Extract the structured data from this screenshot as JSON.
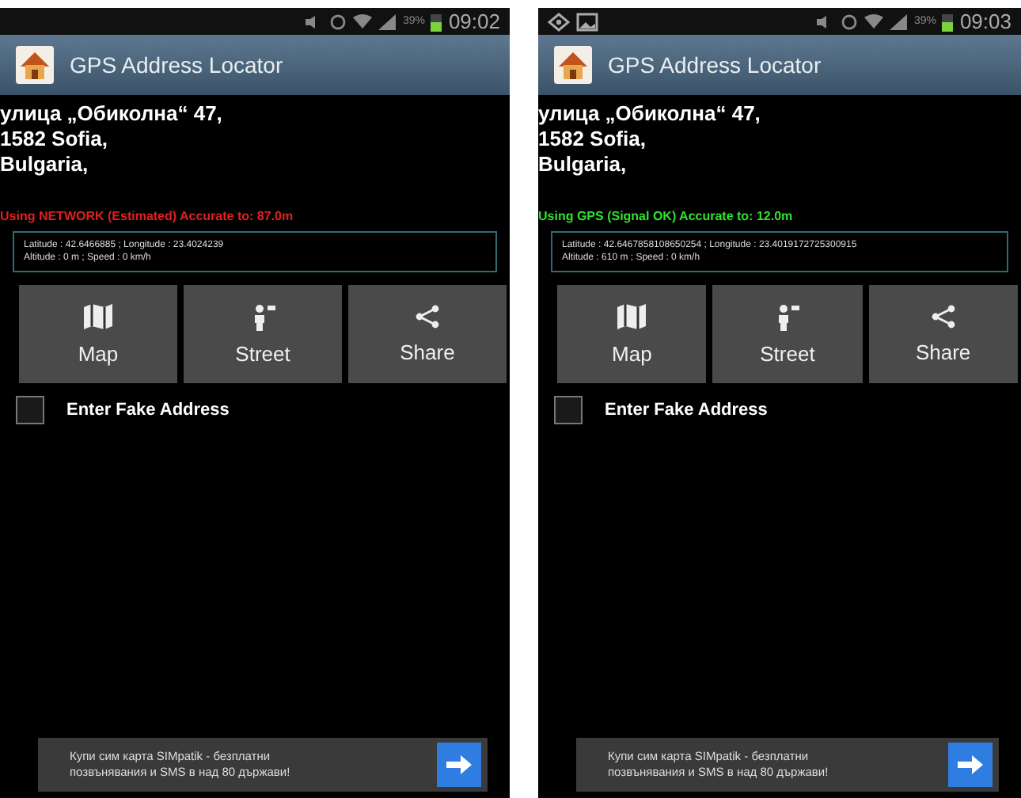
{
  "screens": [
    {
      "status_bar": {
        "time": "09:02",
        "battery": "39%",
        "notification_icons": false
      },
      "app_title": "GPS Address Locator",
      "address": [
        "улица „Обиколна“ 47,",
        "1582 Sofia,",
        "Bulgaria,"
      ],
      "fix_status": {
        "kind": "network",
        "text": "Using NETWORK (Estimated) Accurate to: 87.0m"
      },
      "location_info": [
        "Latitude : 42.6466885 ; Longitude : 23.4024239",
        "Altitude : 0 m ; Speed : 0 km/h"
      ],
      "buttons": [
        {
          "kind": "map",
          "label": "Map"
        },
        {
          "kind": "street",
          "label": "Street"
        },
        {
          "kind": "share",
          "label": "Share"
        }
      ],
      "fake_address": {
        "label": "Enter Fake Address",
        "checked": false
      },
      "ad": {
        "lines": [
          "Купи сим карта SIMpatik - безплатни",
          "позвънявания и SMS в над 80 държави!"
        ]
      }
    },
    {
      "status_bar": {
        "time": "09:03",
        "battery": "39%",
        "notification_icons": true
      },
      "app_title": "GPS Address Locator",
      "address": [
        "улица „Обиколна“ 47,",
        "1582 Sofia,",
        "Bulgaria,"
      ],
      "fix_status": {
        "kind": "gps",
        "text": "Using GPS (Signal OK) Accurate to: 12.0m"
      },
      "location_info": [
        "Latitude : 42.6467858108650254 ; Longitude : 23.4019172725300915",
        "Altitude : 610 m ; Speed : 0 km/h"
      ],
      "buttons": [
        {
          "kind": "map",
          "label": "Map"
        },
        {
          "kind": "street",
          "label": "Street"
        },
        {
          "kind": "share",
          "label": "Share"
        }
      ],
      "fake_address": {
        "label": "Enter Fake Address",
        "checked": false
      },
      "ad": {
        "lines": [
          "Купи сим карта SIMpatik - безплатни",
          "позвънявания и SMS в над 80 държави!"
        ]
      }
    }
  ]
}
